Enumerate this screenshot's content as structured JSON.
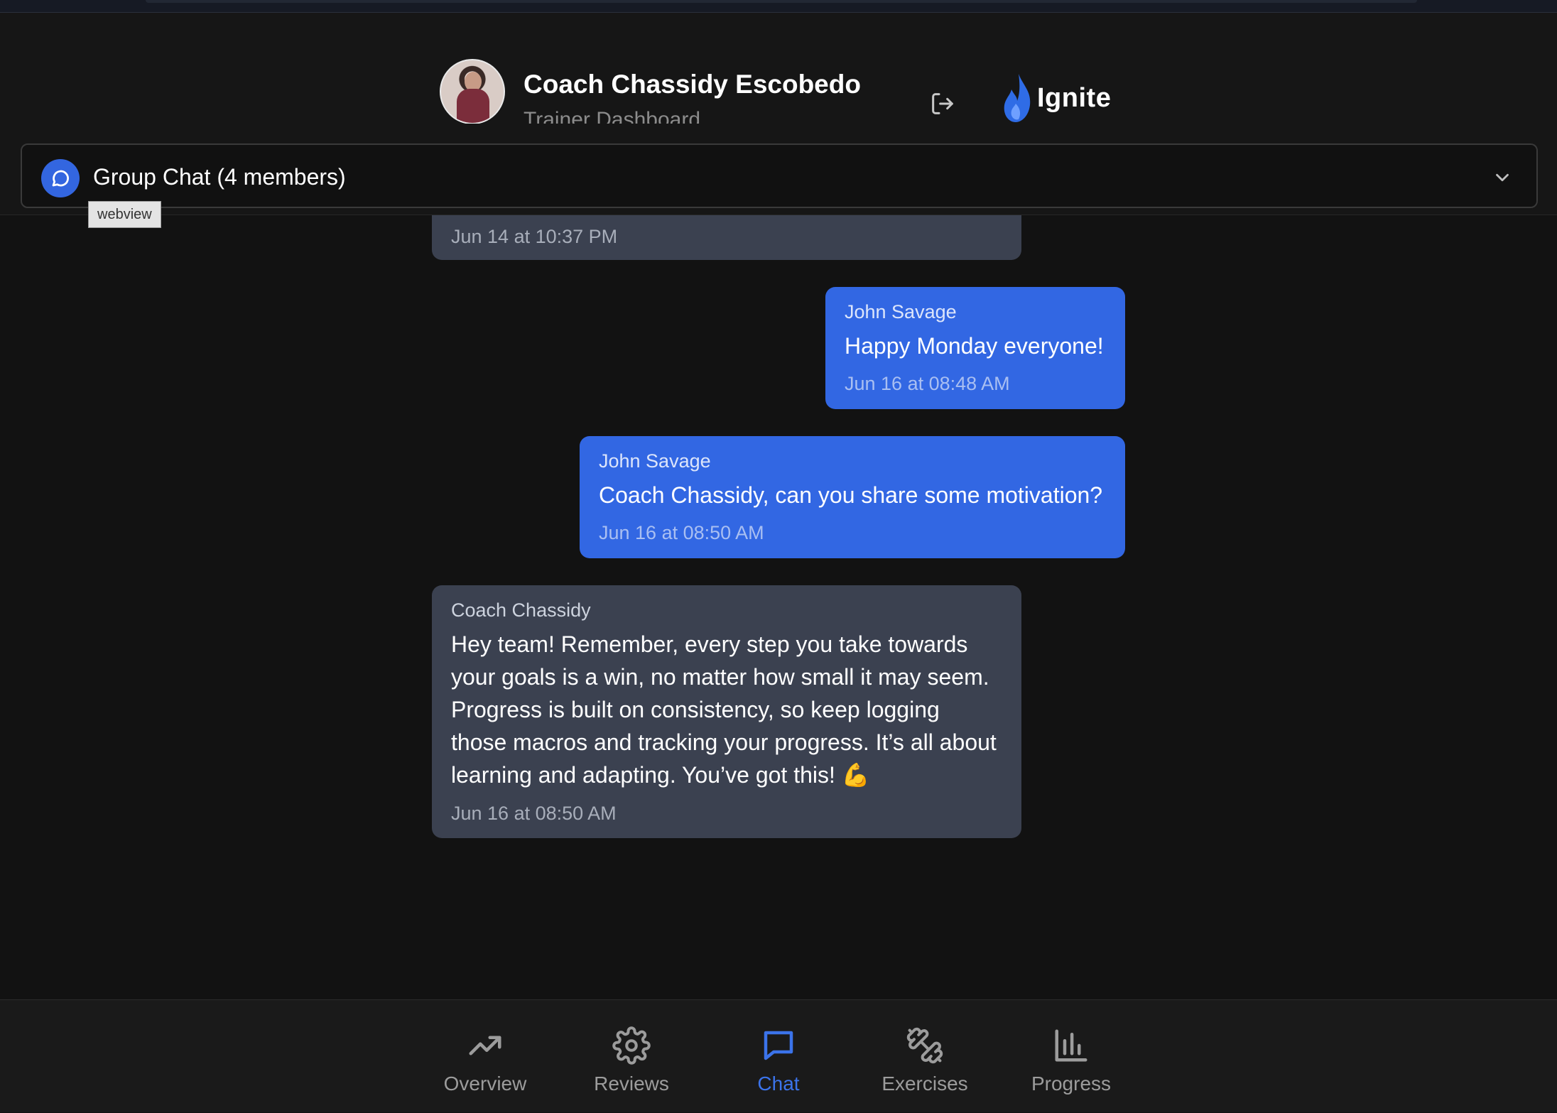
{
  "header": {
    "coach_name": "Coach Chassidy Escobedo",
    "subtitle": "Trainer Dashboard",
    "brand": "Ignite",
    "accent_color": "#3267e3"
  },
  "chat_selector": {
    "label": "Group Chat (4 members)",
    "icon": "chat-bubble-icon",
    "dropdown_icon": "chevron-down-icon"
  },
  "tooltip": "webview",
  "messages": [
    {
      "direction": "in",
      "sender": "",
      "text": "",
      "time": "Jun 14 at 10:37 PM"
    },
    {
      "direction": "out",
      "sender": "John Savage",
      "text": "Happy Monday everyone!",
      "time": "Jun 16 at 08:48 AM"
    },
    {
      "direction": "out",
      "sender": "John Savage",
      "text": "Coach Chassidy, can you share some motivation?",
      "time": "Jun 16 at 08:50 AM"
    },
    {
      "direction": "in",
      "sender": "Coach Chassidy",
      "text_lines": [
        "Hey team! Remember, every step you take towards",
        "your goals is a win, no matter how small it may seem.",
        "Progress is built on consistency, so keep logging",
        "those macros and tracking your progress. It’s all about",
        "learning and adapting. You’ve got this! 💪"
      ],
      "time": "Jun 16 at 08:50 AM"
    }
  ],
  "nav": [
    {
      "label": "Overview",
      "icon": "trending-up-icon",
      "active": false
    },
    {
      "label": "Reviews",
      "icon": "gear-icon",
      "active": false
    },
    {
      "label": "Chat",
      "icon": "chat-icon",
      "active": true
    },
    {
      "label": "Exercises",
      "icon": "dumbbell-icon",
      "active": false
    },
    {
      "label": "Progress",
      "icon": "bar-chart-icon",
      "active": false
    }
  ]
}
